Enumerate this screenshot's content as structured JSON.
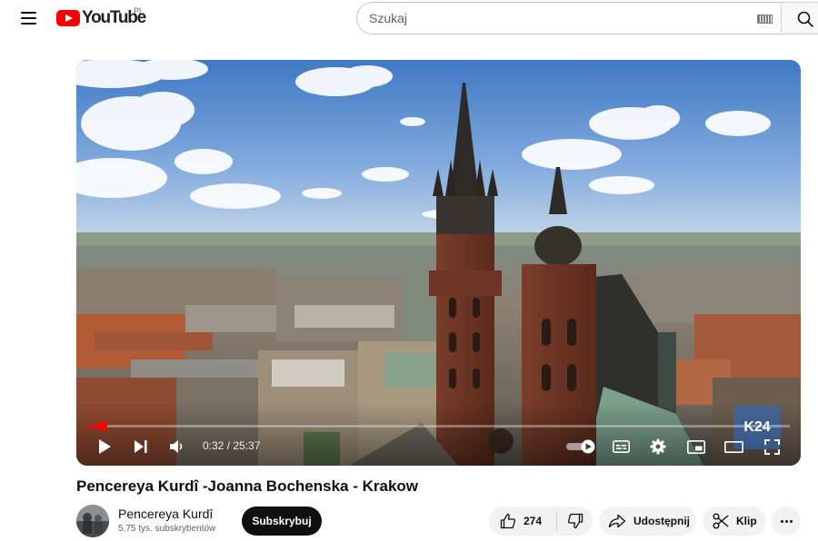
{
  "header": {
    "logo_text": "YouTube",
    "region": "PL",
    "search_placeholder": "Szukaj",
    "icons": [
      "menu-icon",
      "youtube-logo",
      "keyboard-icon",
      "search-icon"
    ]
  },
  "player": {
    "current_time": "0:32",
    "duration": "25:37",
    "time_text": "0:32 / 25:37",
    "progress_fraction": 0.0208,
    "watermark_text": "K24",
    "accent_color": "#ff0000",
    "controls": [
      "play-icon",
      "next-icon",
      "volume-icon",
      "autoplay-toggle",
      "subtitles-icon",
      "settings-icon",
      "miniplayer-icon",
      "theater-mode-icon",
      "fullscreen-icon"
    ]
  },
  "video": {
    "title": "Pencereya Kurdî -Joanna Bochenska - Krakow",
    "channel_name": "Pencereya Kurdî",
    "subscribers": "5,75 tys. subskrybentów",
    "subscribe_label": "Subskrybuj",
    "like_count": "274",
    "share_label": "Udostępnij",
    "clip_label": "Klip"
  }
}
